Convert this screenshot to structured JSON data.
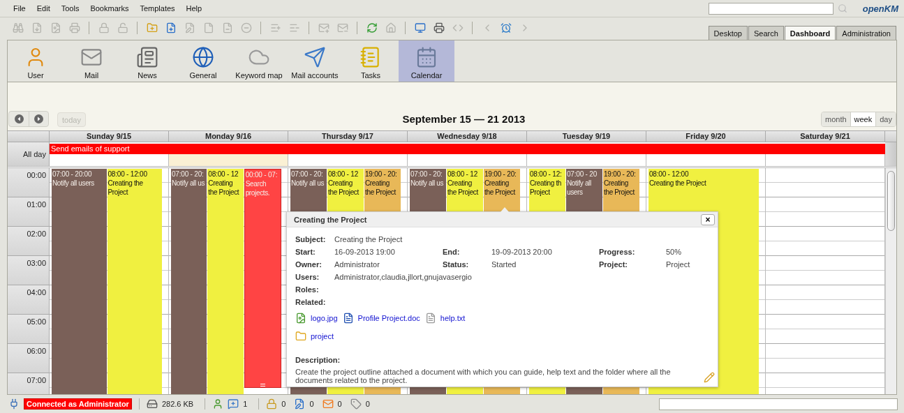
{
  "menu": [
    "File",
    "Edit",
    "Tools",
    "Bookmarks",
    "Templates",
    "Help"
  ],
  "logo": "openKM",
  "toolbar": [
    [
      {
        "kind": "binoculars",
        "disabled": true
      },
      {
        "kind": "file-down",
        "disabled": true
      },
      {
        "kind": "file-image",
        "disabled": true
      },
      {
        "kind": "printer",
        "disabled": true
      }
    ],
    [
      {
        "kind": "lock",
        "disabled": true
      },
      {
        "kind": "unlock",
        "disabled": true
      }
    ],
    [
      {
        "kind": "folder-plus",
        "disabled": false
      },
      {
        "kind": "file-plus",
        "disabled": false
      },
      {
        "kind": "file-pen",
        "disabled": true
      },
      {
        "kind": "file",
        "disabled": true
      },
      {
        "kind": "file-minus",
        "disabled": true
      },
      {
        "kind": "circle-minus",
        "disabled": true
      }
    ],
    [
      {
        "kind": "list-plus",
        "disabled": true
      },
      {
        "kind": "list-minus",
        "disabled": true
      }
    ],
    [
      {
        "kind": "mail-plus",
        "disabled": true
      },
      {
        "kind": "mail-minus",
        "disabled": true
      }
    ],
    [
      {
        "kind": "refresh",
        "disabled": false
      },
      {
        "kind": "home",
        "disabled": true
      }
    ],
    [
      {
        "kind": "monitor",
        "disabled": false
      },
      {
        "kind": "printer",
        "disabled": false
      },
      {
        "kind": "code",
        "disabled": true
      }
    ],
    [
      {
        "kind": "back",
        "disabled": true
      },
      {
        "kind": "alarm",
        "disabled": false
      },
      {
        "kind": "forward",
        "disabled": true
      }
    ]
  ],
  "tabs": [
    {
      "label": "Desktop",
      "selected": false
    },
    {
      "label": "Search",
      "selected": false
    },
    {
      "label": "Dashboard",
      "selected": true
    },
    {
      "label": "Administration",
      "selected": false
    }
  ],
  "modules": [
    {
      "label": "User",
      "kind": "user",
      "selected": false
    },
    {
      "label": "Mail",
      "kind": "mail",
      "selected": false
    },
    {
      "label": "News",
      "kind": "news",
      "selected": false
    },
    {
      "label": "General",
      "kind": "globe",
      "selected": false
    },
    {
      "label": "Keyword map",
      "kind": "cloud",
      "selected": false
    },
    {
      "label": "Mail accounts",
      "kind": "send",
      "selected": false
    },
    {
      "label": "Tasks",
      "kind": "tasks",
      "selected": false
    },
    {
      "label": "Calendar",
      "kind": "calendar",
      "selected": true
    }
  ],
  "calendar": {
    "today_button": {
      "label": "today",
      "disabled": true
    },
    "title": "September 15 — 21 2013",
    "views": [
      {
        "label": "month",
        "selected": false
      },
      {
        "label": "week",
        "selected": true
      },
      {
        "label": "day",
        "selected": false
      }
    ],
    "all_day_label": "All day",
    "all_day_event": {
      "title": "Send emails of support",
      "color": "#ff0000"
    },
    "hours": [
      "00:00",
      "01:00",
      "02:00",
      "03:00",
      "04:00",
      "05:00",
      "06:00",
      "07:00"
    ],
    "days": [
      {
        "label": "Sunday 9/15",
        "today": false,
        "events": [
          {
            "time": "07:00 - 20:00",
            "title": "Notify all users",
            "color": "#7a6058",
            "ends_in_view": false
          },
          {
            "time": "08:00 - 12:00",
            "title": "Creating the Project",
            "color": "#f0f040",
            "ends_in_view": false
          }
        ]
      },
      {
        "label": "Monday 9/16",
        "today": true,
        "events": [
          {
            "time": "07:00 - 20:",
            "title": "Notify all us",
            "color": "#7a6058",
            "ends_in_view": false
          },
          {
            "time": "08:00 - 12",
            "title": "Creating the Project",
            "color": "#f0f040",
            "ends_in_view": false
          },
          {
            "time": "00:00 - 07:",
            "title": "Search projects.",
            "color": "#ff4444",
            "ends_in_view": true
          }
        ]
      },
      {
        "label": "Thursday 9/17",
        "today": false,
        "events": [
          {
            "time": "07:00 - 20:",
            "title": "Notify all us",
            "color": "#7a6058",
            "ends_in_view": false
          },
          {
            "time": "08:00 - 12",
            "title": "Creating the Project",
            "color": "#f0f040",
            "ends_in_view": false
          },
          {
            "time": "19:00 - 20:",
            "title": "Creating the Project",
            "color": "#e8b858",
            "ends_in_view": false
          }
        ]
      },
      {
        "label": "Wednesday 9/18",
        "today": false,
        "events": [
          {
            "time": "07:00 - 20:",
            "title": "Notify all us",
            "color": "#7a6058",
            "ends_in_view": false
          },
          {
            "time": "08:00 - 12",
            "title": "Creating the Project",
            "color": "#f0f040",
            "ends_in_view": false
          },
          {
            "time": "19:00 - 20:",
            "title": "Creating the Project",
            "color": "#e8b858",
            "ends_in_view": false
          }
        ]
      },
      {
        "label": "Tuesday 9/19",
        "today": false,
        "events": [
          {
            "time": "08:00 - 12:",
            "title": "Creating th Project",
            "color": "#f0f040",
            "ends_in_view": false
          },
          {
            "time": "07:00 - 20",
            "title": "Notify all users",
            "color": "#7a6058",
            "ends_in_view": false
          },
          {
            "time": "19:00 - 20:",
            "title": "Creating the Project",
            "color": "#e8b858",
            "ends_in_view": false
          }
        ]
      },
      {
        "label": "Friday 9/20",
        "today": false,
        "events": [
          {
            "time": "08:00 - 12:00",
            "title": "Creating the Project",
            "color": "#f0f040",
            "ends_in_view": false
          }
        ]
      },
      {
        "label": "Saturday 9/21",
        "today": false
      }
    ]
  },
  "popup": {
    "title": "Creating the Project",
    "close": "×",
    "rows": [
      [
        {
          "label": "Subject:",
          "value": "Creating the Project"
        }
      ],
      [
        {
          "label": "Start:",
          "value": "16-09-2013 19:00"
        },
        {
          "label": "End:",
          "value": "19-09-2013 20:00"
        },
        {
          "label": "Progress:",
          "value": "50%"
        }
      ],
      [
        {
          "label": "Owner:",
          "value": "Administrator"
        },
        {
          "label": "Status:",
          "value": "Started"
        },
        {
          "label": "Project:",
          "value": "Project"
        }
      ],
      [
        {
          "label": "Users:",
          "value": "Administrator,claudia,jllort,gnujavasergio"
        }
      ],
      [
        {
          "label": "Roles:"
        }
      ],
      [
        {
          "label": "Related:"
        }
      ]
    ],
    "attachment_rows": [
      [
        {
          "name": "logo.jpg",
          "kind": "image"
        },
        {
          "name": "Profile Project.doc",
          "kind": "word"
        },
        {
          "name": "help.txt",
          "kind": "text"
        }
      ],
      [
        {
          "name": "project",
          "kind": "folder"
        }
      ]
    ],
    "description_label": "Description:",
    "description": "Create the project outline attached a document with which you can guide, help text and the folder where all the documents related to the project."
  },
  "status_bar": {
    "connection": "Connected as Administrator",
    "size": "282.6 KB",
    "groups": [
      [
        {
          "kind": "user"
        },
        {
          "kind": "chat",
          "count": "1"
        }
      ],
      [
        {
          "kind": "lock",
          "count": "0"
        },
        {
          "kind": "edit",
          "count": "0"
        },
        {
          "kind": "mail",
          "count": "0"
        },
        {
          "kind": "tag",
          "count": "0"
        }
      ]
    ]
  }
}
